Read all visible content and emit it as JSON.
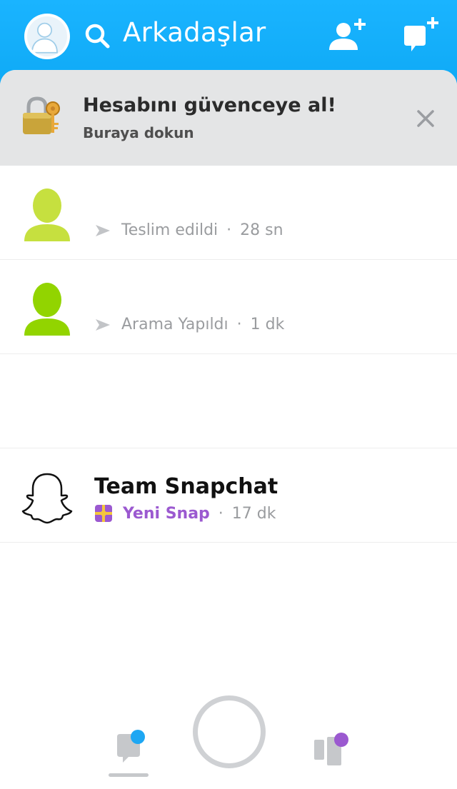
{
  "header": {
    "title": "Arkadaşlar",
    "icons": {
      "profile": "avatar-icon",
      "search": "search-icon",
      "add_friend": "add-friend-icon",
      "new_chat": "new-chat-icon"
    }
  },
  "banner": {
    "title": "Hesabını güvenceye al!",
    "subtitle": "Buraya dokun",
    "icon": "lock-key-icon",
    "close_icon": "close-icon"
  },
  "chats": [
    {
      "name": "",
      "status": "Teslim edildi",
      "time": "28 sn",
      "avatar_color": "#c6e03f"
    },
    {
      "name": "",
      "status": "Arama Yapıldı",
      "time": "1 dk",
      "avatar_color": "#92d400"
    },
    {
      "name": "",
      "status": "",
      "time": ""
    },
    {
      "name": "Team Snapchat",
      "status": "Yeni Snap",
      "time": "17 dk",
      "status_color": "#9b59d0"
    }
  ],
  "separator": "·",
  "bottom_nav": {
    "chat_icon": "chat-icon",
    "chat_badge_color": "#1ea7f3",
    "discover_icon": "discover-icon",
    "discover_badge_color": "#9b59d0"
  },
  "colors": {
    "header_bg": "#10abf5",
    "banner_bg": "#e4e5e6"
  }
}
